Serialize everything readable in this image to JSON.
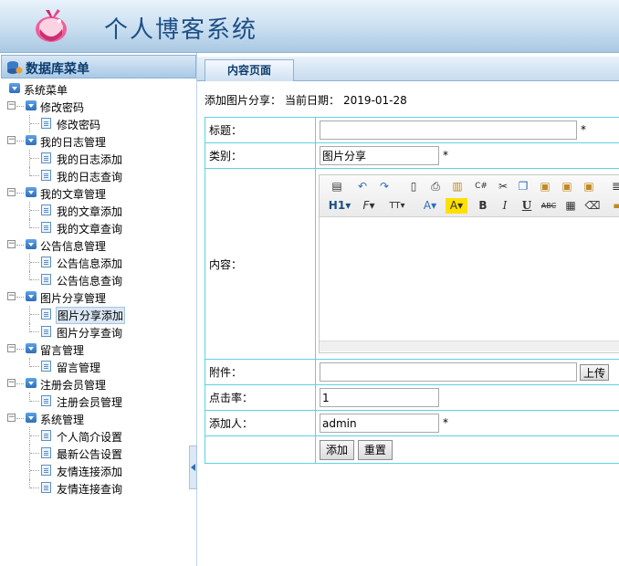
{
  "header": {
    "title": "个人博客系统"
  },
  "sidebar": {
    "title": "数据库菜单",
    "root": "系统菜单",
    "groups": [
      {
        "label": "修改密码",
        "items": [
          "修改密码"
        ]
      },
      {
        "label": "我的日志管理",
        "items": [
          "我的日志添加",
          "我的日志查询"
        ]
      },
      {
        "label": "我的文章管理",
        "items": [
          "我的文章添加",
          "我的文章查询"
        ]
      },
      {
        "label": "公告信息管理",
        "items": [
          "公告信息添加",
          "公告信息查询"
        ]
      },
      {
        "label": "图片分享管理",
        "items": [
          "图片分享添加",
          "图片分享查询"
        ]
      },
      {
        "label": "留言管理",
        "items": [
          "留言管理"
        ]
      },
      {
        "label": "注册会员管理",
        "items": [
          "注册会员管理"
        ]
      },
      {
        "label": "系统管理",
        "items": [
          "个人简介设置",
          "最新公告设置",
          "友情连接添加",
          "友情连接查询"
        ]
      }
    ],
    "active_item": "图片分享添加"
  },
  "main": {
    "tab": "内容页面",
    "info": {
      "action": "添加图片分享：",
      "date_label": "当前日期：",
      "date": "2019-01-28"
    },
    "form": {
      "title_label": "标题：",
      "title_value": "",
      "category_label": "类别：",
      "category_value": "图片分享",
      "content_label": "内容：",
      "attachment_label": "附件：",
      "attachment_value": "",
      "upload_button": "上传",
      "clicks_label": "点击率：",
      "clicks_value": "1",
      "author_label": "添加人：",
      "author_value": "admin",
      "required_mark": "*",
      "submit_button": "添加",
      "reset_button": "重置"
    }
  },
  "editor_toolbar": {
    "row1": [
      "source-icon",
      "undo-icon",
      "redo-icon",
      "preview-icon",
      "print-icon",
      "template-icon",
      "code-icon",
      "cut-icon",
      "copy-icon",
      "paste-icon",
      "paste-text-icon",
      "paste-word-icon",
      "align-icon"
    ],
    "row2_text": {
      "heading": "H1",
      "font": "F",
      "font_size": "TT",
      "bold": "B",
      "italic": "I",
      "underline": "U",
      "strike": "ABC"
    }
  }
}
